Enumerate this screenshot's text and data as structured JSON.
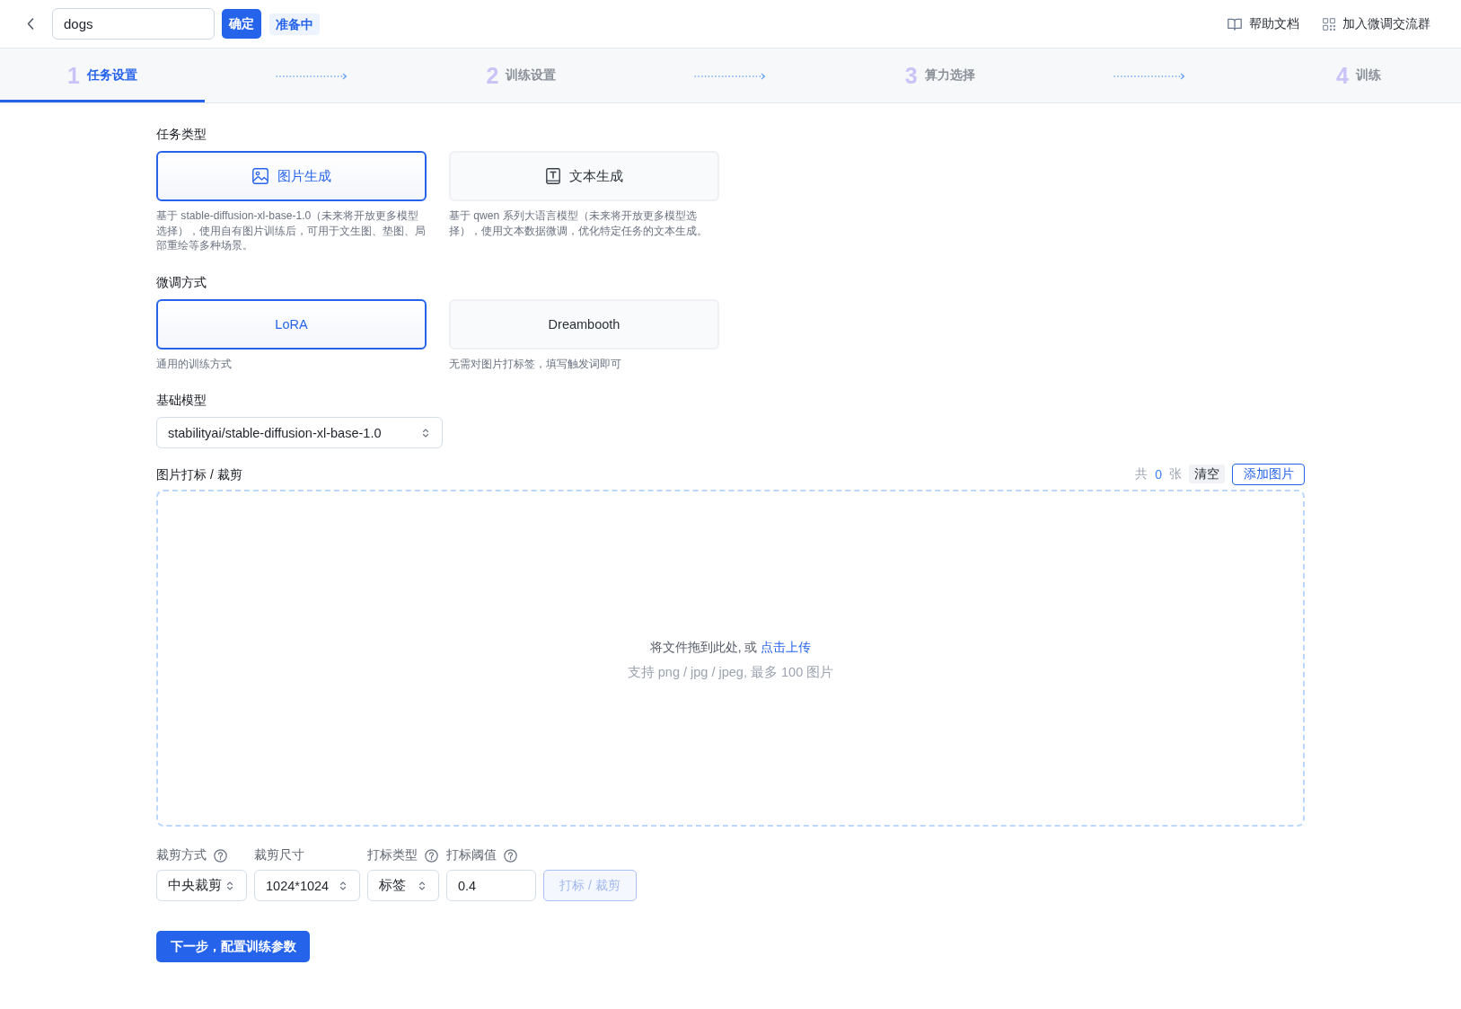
{
  "header": {
    "name_field": {
      "value": "dogs"
    },
    "confirm_button": "确定",
    "status_badge": "准备中",
    "links": [
      {
        "label": "帮助文档",
        "kind": "book"
      },
      {
        "label": "加入微调交流群",
        "kind": "qrcode"
      }
    ]
  },
  "steps": [
    {
      "number": "1",
      "label": "任务设置",
      "selected": true
    },
    {
      "number": "2",
      "label": "训练设置",
      "selected": false
    },
    {
      "number": "3",
      "label": "算力选择",
      "selected": false
    },
    {
      "number": "4",
      "label": "训练",
      "selected": false
    }
  ],
  "task_type": {
    "label": "任务类型",
    "options": [
      {
        "label": "图片生成",
        "kind": "image",
        "selected": true,
        "description": "基于 stable-diffusion-xl-base-1.0（未来将开放更多模型选择），使用自有图片训练后，可用于文生图、垫图、局部重绘等多种场景。"
      },
      {
        "label": "文本生成",
        "kind": "text",
        "selected": false,
        "description": "基于 qwen 系列大语言模型（未来将开放更多模型选择），使用文本数据微调，优化特定任务的文本生成。"
      }
    ]
  },
  "finetune_method": {
    "label": "微调方式",
    "options": [
      {
        "label": "LoRA",
        "selected": true,
        "description": "通用的训练方式"
      },
      {
        "label": "Dreambooth",
        "selected": false,
        "description": "无需对图片打标签，填写触发词即可"
      }
    ]
  },
  "base_model": {
    "label": "基础模型",
    "value": "stabilityai/stable-diffusion-xl-base-1.0"
  },
  "image_tagging": {
    "label": "图片打标 / 裁剪",
    "count_prefix": "共",
    "count": "0",
    "count_suffix": "张",
    "clear_button": "清空",
    "add_button": "添加图片",
    "dropzone": {
      "text": "将文件拖到此处, 或",
      "link": "点击上传",
      "hint": "支持 png / jpg / jpeg, 最多 100 图片"
    }
  },
  "settings": [
    {
      "label": "裁剪方式",
      "help": true,
      "kind": "select",
      "value": "中央裁剪"
    },
    {
      "label": "裁剪尺寸",
      "help": false,
      "kind": "select",
      "value": "1024*1024"
    },
    {
      "label": "打标类型",
      "help": true,
      "kind": "select",
      "value": "标签"
    },
    {
      "label": "打标阈值",
      "help": true,
      "kind": "input",
      "value": "0.4"
    }
  ],
  "tag_crop_button": {
    "label": "打标 / 裁剪",
    "disabled": true
  },
  "next_button": "下一步，配置训练参数"
}
